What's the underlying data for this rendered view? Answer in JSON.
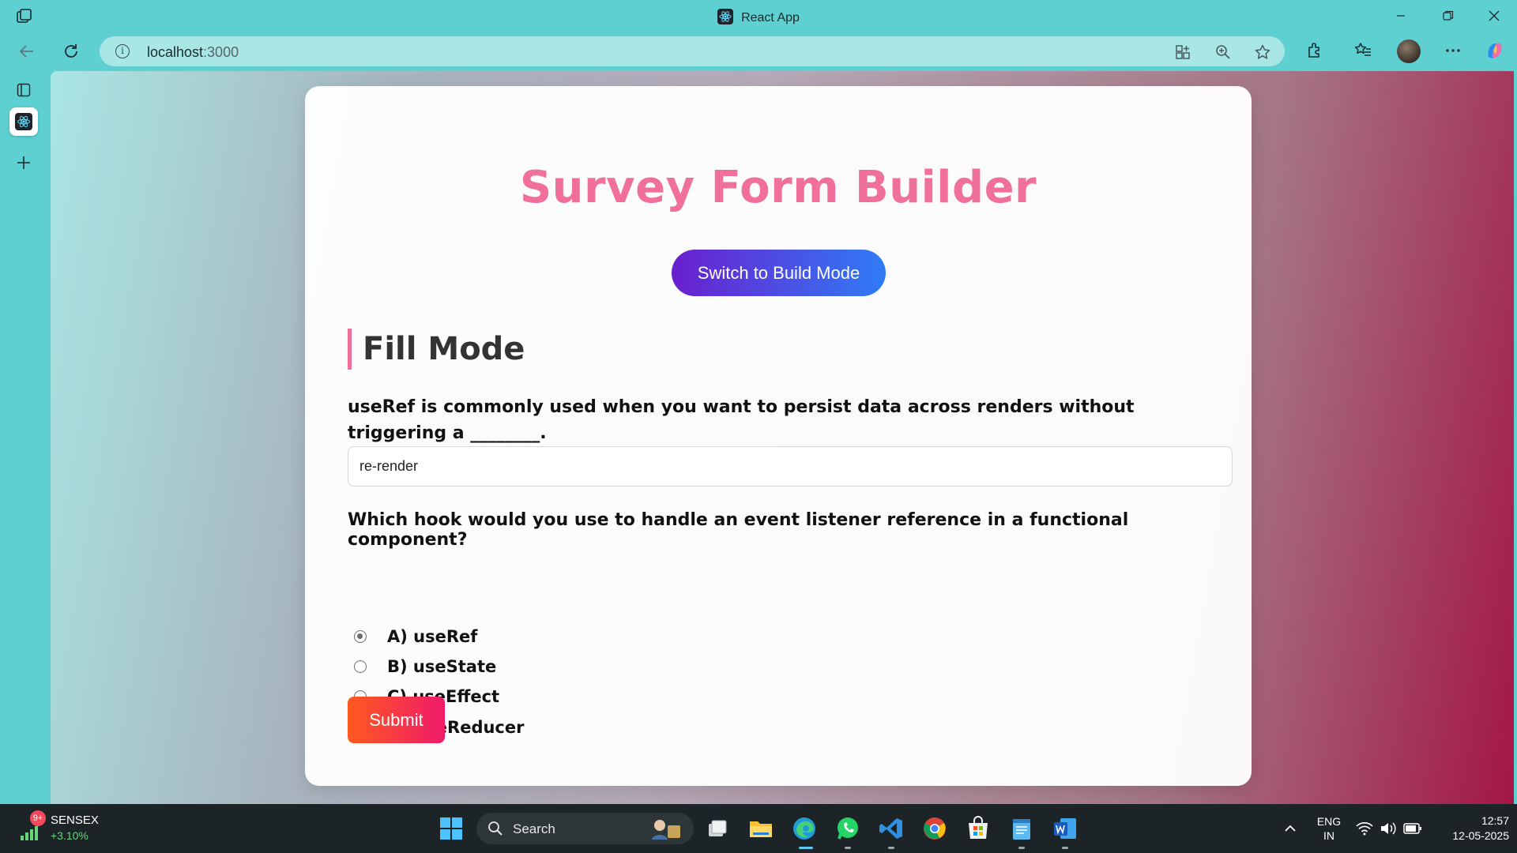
{
  "window": {
    "title": "React App"
  },
  "address_bar": {
    "host": "localhost",
    "port": ":3000"
  },
  "page": {
    "heading": "Survey Form Builder",
    "mode_button_label": "Switch to Build Mode",
    "section_title": "Fill Mode",
    "question1": {
      "text": "useRef is commonly used when you want to persist data across renders without triggering a ________.",
      "answer_value": "re-render"
    },
    "question2": {
      "text": "Which hook would you use to handle an event listener reference in a functional component?",
      "options": [
        {
          "label": "A) useRef",
          "checked": true
        },
        {
          "label": "B) useState",
          "checked": false
        },
        {
          "label": "C) useEffect",
          "checked": false
        },
        {
          "label": "D) useReducer",
          "checked": false
        }
      ]
    },
    "submit_label": "Submit"
  },
  "taskbar": {
    "ticker_badge": "9+",
    "ticker_name": "SENSEX",
    "ticker_value": "+3.10%",
    "search_label": "Search",
    "language_line1": "ENG",
    "language_line2": "IN",
    "time": "12:57",
    "date": "12-05-2025"
  },
  "colors": {
    "heading": "#f0709a",
    "mode_button_start": "#6a1fcf",
    "mode_button_end": "#2f7cf5",
    "submit_start": "#ff5a1f",
    "submit_end": "#ef1a6a",
    "browser_frame": "#5ed0d1"
  },
  "icons": [
    "workspaces-icon",
    "react-favicon-icon",
    "minimize-icon",
    "restore-icon",
    "close-icon",
    "back-icon",
    "reload-icon",
    "info-icon",
    "app-available-icon",
    "zoom-icon",
    "favorite-star-icon",
    "extensions-icon",
    "favorites-icon",
    "profile-avatar",
    "more-menu-icon",
    "copilot-icon",
    "tab-actions-icon",
    "new-tab-icon",
    "windows-start-icon",
    "search-icon",
    "task-view-icon",
    "file-explorer-icon",
    "edge-icon",
    "whatsapp-icon",
    "vscode-icon",
    "chrome-icon",
    "microsoft-store-icon",
    "notepad-icon",
    "word-icon",
    "chevron-up-icon",
    "wifi-icon",
    "volume-icon",
    "battery-icon"
  ]
}
